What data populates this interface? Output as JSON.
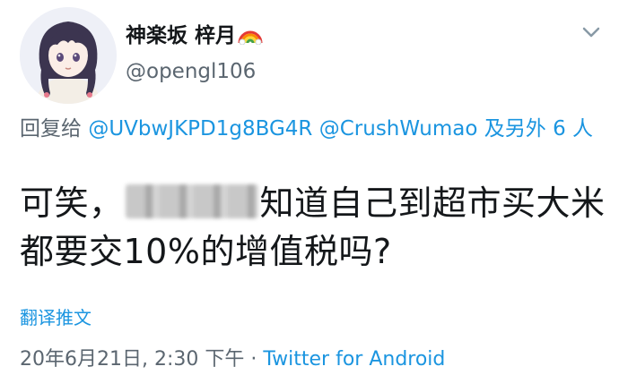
{
  "user": {
    "display_name": "神楽坂 梓月",
    "name_emoji": "rainbow-icon",
    "handle": "@opengl106",
    "avatar": "anime-girl-avatar"
  },
  "reply": {
    "prefix": "回复给 ",
    "mention_1": "@UVbwJKPD1g8BG4R",
    "mention_2": "@CrushWumao",
    "others": " 及另外 6 人"
  },
  "tweet": {
    "text_before": "可笑，",
    "text_after": "知道自己到超市买大米都要交10%的增值税吗?"
  },
  "translate_label": "翻译推文",
  "meta": {
    "timestamp": "20年6月21日, 2:30 下午",
    "separator": " · ",
    "source": "Twitter for Android"
  },
  "colors": {
    "link": "#1b95e0",
    "secondary": "#5b6670",
    "text": "#14171a"
  }
}
